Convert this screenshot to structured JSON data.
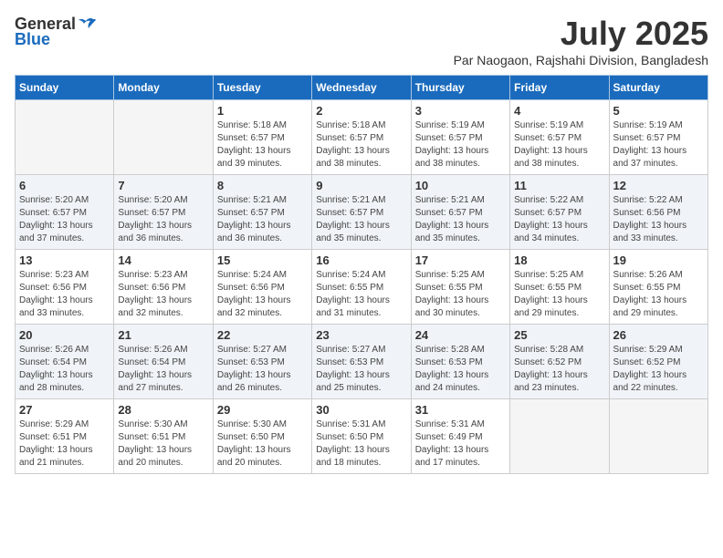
{
  "logo": {
    "general": "General",
    "blue": "Blue"
  },
  "title": {
    "month": "July 2025",
    "location": "Par Naogaon, Rajshahi Division, Bangladesh"
  },
  "weekdays": [
    "Sunday",
    "Monday",
    "Tuesday",
    "Wednesday",
    "Thursday",
    "Friday",
    "Saturday"
  ],
  "weeks": [
    [
      {
        "day": "",
        "sunrise": "",
        "sunset": "",
        "daylight": ""
      },
      {
        "day": "",
        "sunrise": "",
        "sunset": "",
        "daylight": ""
      },
      {
        "day": "1",
        "sunrise": "Sunrise: 5:18 AM",
        "sunset": "Sunset: 6:57 PM",
        "daylight": "Daylight: 13 hours and 39 minutes."
      },
      {
        "day": "2",
        "sunrise": "Sunrise: 5:18 AM",
        "sunset": "Sunset: 6:57 PM",
        "daylight": "Daylight: 13 hours and 38 minutes."
      },
      {
        "day": "3",
        "sunrise": "Sunrise: 5:19 AM",
        "sunset": "Sunset: 6:57 PM",
        "daylight": "Daylight: 13 hours and 38 minutes."
      },
      {
        "day": "4",
        "sunrise": "Sunrise: 5:19 AM",
        "sunset": "Sunset: 6:57 PM",
        "daylight": "Daylight: 13 hours and 38 minutes."
      },
      {
        "day": "5",
        "sunrise": "Sunrise: 5:19 AM",
        "sunset": "Sunset: 6:57 PM",
        "daylight": "Daylight: 13 hours and 37 minutes."
      }
    ],
    [
      {
        "day": "6",
        "sunrise": "Sunrise: 5:20 AM",
        "sunset": "Sunset: 6:57 PM",
        "daylight": "Daylight: 13 hours and 37 minutes."
      },
      {
        "day": "7",
        "sunrise": "Sunrise: 5:20 AM",
        "sunset": "Sunset: 6:57 PM",
        "daylight": "Daylight: 13 hours and 36 minutes."
      },
      {
        "day": "8",
        "sunrise": "Sunrise: 5:21 AM",
        "sunset": "Sunset: 6:57 PM",
        "daylight": "Daylight: 13 hours and 36 minutes."
      },
      {
        "day": "9",
        "sunrise": "Sunrise: 5:21 AM",
        "sunset": "Sunset: 6:57 PM",
        "daylight": "Daylight: 13 hours and 35 minutes."
      },
      {
        "day": "10",
        "sunrise": "Sunrise: 5:21 AM",
        "sunset": "Sunset: 6:57 PM",
        "daylight": "Daylight: 13 hours and 35 minutes."
      },
      {
        "day": "11",
        "sunrise": "Sunrise: 5:22 AM",
        "sunset": "Sunset: 6:57 PM",
        "daylight": "Daylight: 13 hours and 34 minutes."
      },
      {
        "day": "12",
        "sunrise": "Sunrise: 5:22 AM",
        "sunset": "Sunset: 6:56 PM",
        "daylight": "Daylight: 13 hours and 33 minutes."
      }
    ],
    [
      {
        "day": "13",
        "sunrise": "Sunrise: 5:23 AM",
        "sunset": "Sunset: 6:56 PM",
        "daylight": "Daylight: 13 hours and 33 minutes."
      },
      {
        "day": "14",
        "sunrise": "Sunrise: 5:23 AM",
        "sunset": "Sunset: 6:56 PM",
        "daylight": "Daylight: 13 hours and 32 minutes."
      },
      {
        "day": "15",
        "sunrise": "Sunrise: 5:24 AM",
        "sunset": "Sunset: 6:56 PM",
        "daylight": "Daylight: 13 hours and 32 minutes."
      },
      {
        "day": "16",
        "sunrise": "Sunrise: 5:24 AM",
        "sunset": "Sunset: 6:55 PM",
        "daylight": "Daylight: 13 hours and 31 minutes."
      },
      {
        "day": "17",
        "sunrise": "Sunrise: 5:25 AM",
        "sunset": "Sunset: 6:55 PM",
        "daylight": "Daylight: 13 hours and 30 minutes."
      },
      {
        "day": "18",
        "sunrise": "Sunrise: 5:25 AM",
        "sunset": "Sunset: 6:55 PM",
        "daylight": "Daylight: 13 hours and 29 minutes."
      },
      {
        "day": "19",
        "sunrise": "Sunrise: 5:26 AM",
        "sunset": "Sunset: 6:55 PM",
        "daylight": "Daylight: 13 hours and 29 minutes."
      }
    ],
    [
      {
        "day": "20",
        "sunrise": "Sunrise: 5:26 AM",
        "sunset": "Sunset: 6:54 PM",
        "daylight": "Daylight: 13 hours and 28 minutes."
      },
      {
        "day": "21",
        "sunrise": "Sunrise: 5:26 AM",
        "sunset": "Sunset: 6:54 PM",
        "daylight": "Daylight: 13 hours and 27 minutes."
      },
      {
        "day": "22",
        "sunrise": "Sunrise: 5:27 AM",
        "sunset": "Sunset: 6:53 PM",
        "daylight": "Daylight: 13 hours and 26 minutes."
      },
      {
        "day": "23",
        "sunrise": "Sunrise: 5:27 AM",
        "sunset": "Sunset: 6:53 PM",
        "daylight": "Daylight: 13 hours and 25 minutes."
      },
      {
        "day": "24",
        "sunrise": "Sunrise: 5:28 AM",
        "sunset": "Sunset: 6:53 PM",
        "daylight": "Daylight: 13 hours and 24 minutes."
      },
      {
        "day": "25",
        "sunrise": "Sunrise: 5:28 AM",
        "sunset": "Sunset: 6:52 PM",
        "daylight": "Daylight: 13 hours and 23 minutes."
      },
      {
        "day": "26",
        "sunrise": "Sunrise: 5:29 AM",
        "sunset": "Sunset: 6:52 PM",
        "daylight": "Daylight: 13 hours and 22 minutes."
      }
    ],
    [
      {
        "day": "27",
        "sunrise": "Sunrise: 5:29 AM",
        "sunset": "Sunset: 6:51 PM",
        "daylight": "Daylight: 13 hours and 21 minutes."
      },
      {
        "day": "28",
        "sunrise": "Sunrise: 5:30 AM",
        "sunset": "Sunset: 6:51 PM",
        "daylight": "Daylight: 13 hours and 20 minutes."
      },
      {
        "day": "29",
        "sunrise": "Sunrise: 5:30 AM",
        "sunset": "Sunset: 6:50 PM",
        "daylight": "Daylight: 13 hours and 20 minutes."
      },
      {
        "day": "30",
        "sunrise": "Sunrise: 5:31 AM",
        "sunset": "Sunset: 6:50 PM",
        "daylight": "Daylight: 13 hours and 18 minutes."
      },
      {
        "day": "31",
        "sunrise": "Sunrise: 5:31 AM",
        "sunset": "Sunset: 6:49 PM",
        "daylight": "Daylight: 13 hours and 17 minutes."
      },
      {
        "day": "",
        "sunrise": "",
        "sunset": "",
        "daylight": ""
      },
      {
        "day": "",
        "sunrise": "",
        "sunset": "",
        "daylight": ""
      }
    ]
  ]
}
